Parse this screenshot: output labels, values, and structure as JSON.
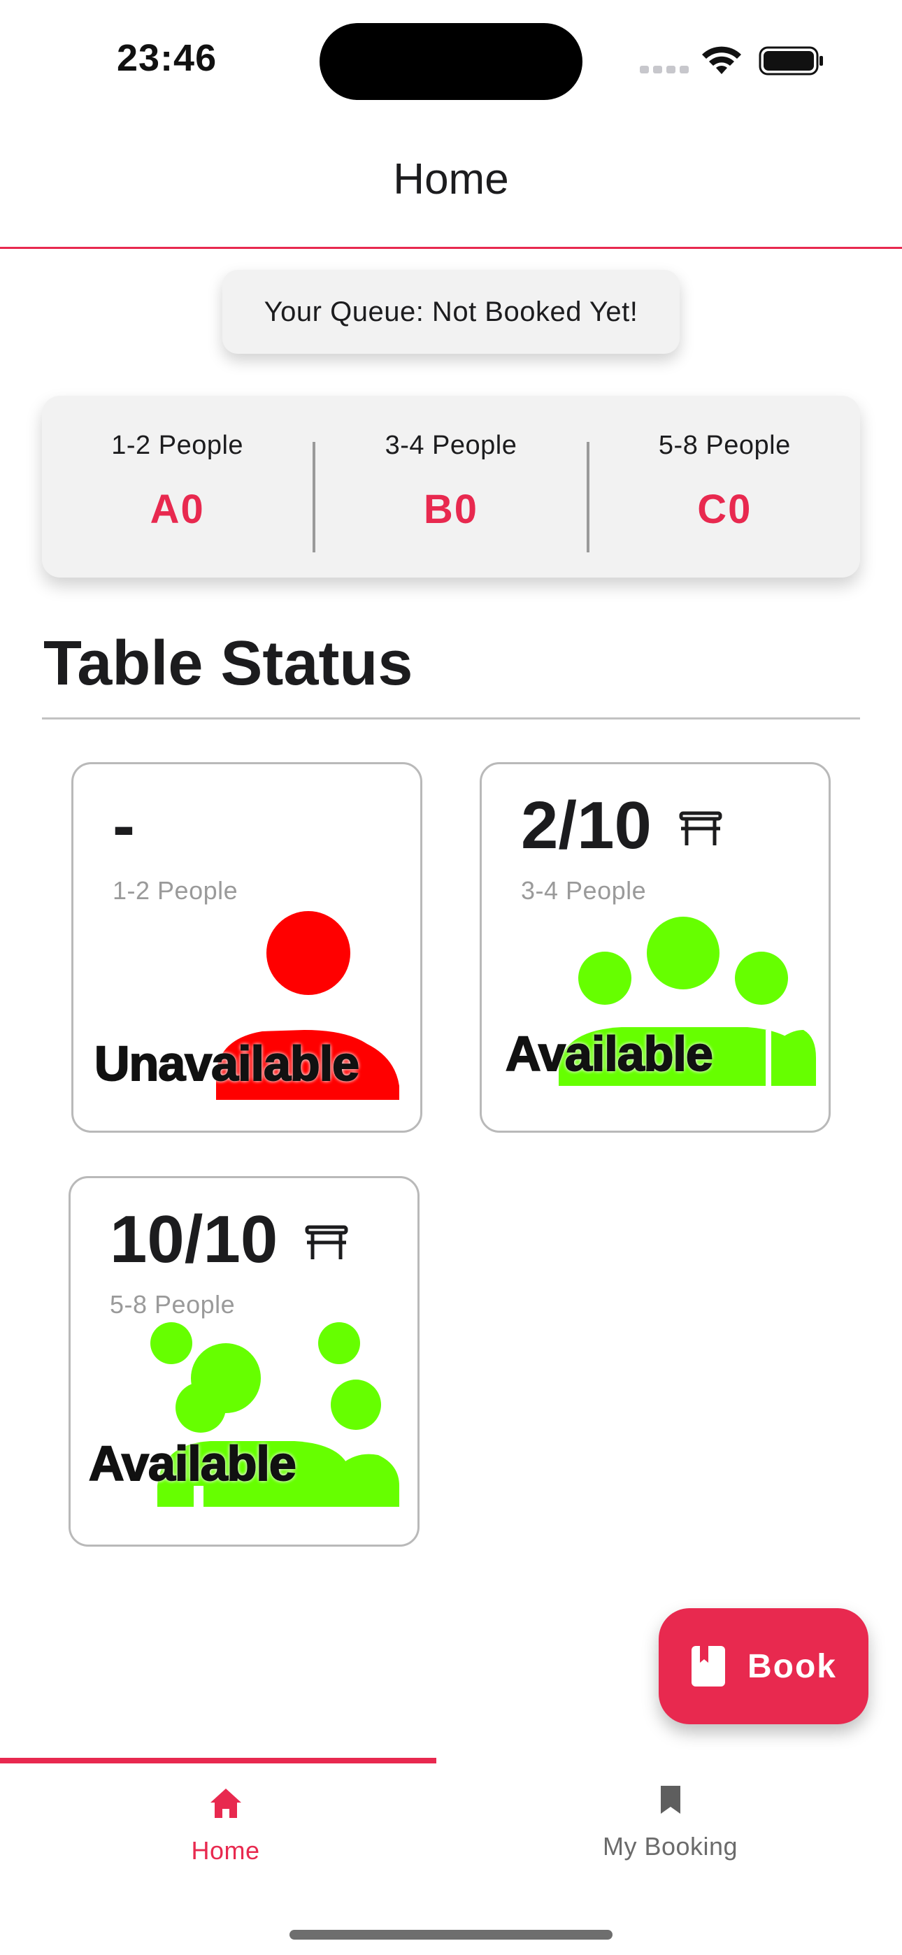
{
  "status_bar": {
    "time": "23:46"
  },
  "header": {
    "title": "Home"
  },
  "queue": {
    "message": "Your Queue: Not Booked Yet!",
    "groups": [
      {
        "label": "1-2 People",
        "code": "A0"
      },
      {
        "label": "3-4 People",
        "code": "B0"
      },
      {
        "label": "5-8 People",
        "code": "C0"
      }
    ]
  },
  "section": {
    "title": "Table Status"
  },
  "tables": [
    {
      "count": "-",
      "group": "1-2 People",
      "status": "Unavailable",
      "status_color": "#ff0000",
      "show_icon": false
    },
    {
      "count": "2/10",
      "group": "3-4 People",
      "status": "Available",
      "status_color": "#66ff00",
      "show_icon": true
    },
    {
      "count": "10/10",
      "group": "5-8 People",
      "status": "Available",
      "status_color": "#66ff00",
      "show_icon": true
    }
  ],
  "fab": {
    "label": "Book",
    "icon": "book-icon"
  },
  "nav": {
    "items": [
      {
        "label": "Home",
        "icon": "home-icon",
        "active": true
      },
      {
        "label": "My Booking",
        "icon": "bookmark-icon",
        "active": false
      }
    ]
  },
  "colors": {
    "accent": "#e8294f",
    "available": "#66ff00",
    "unavailable": "#ff0000"
  }
}
